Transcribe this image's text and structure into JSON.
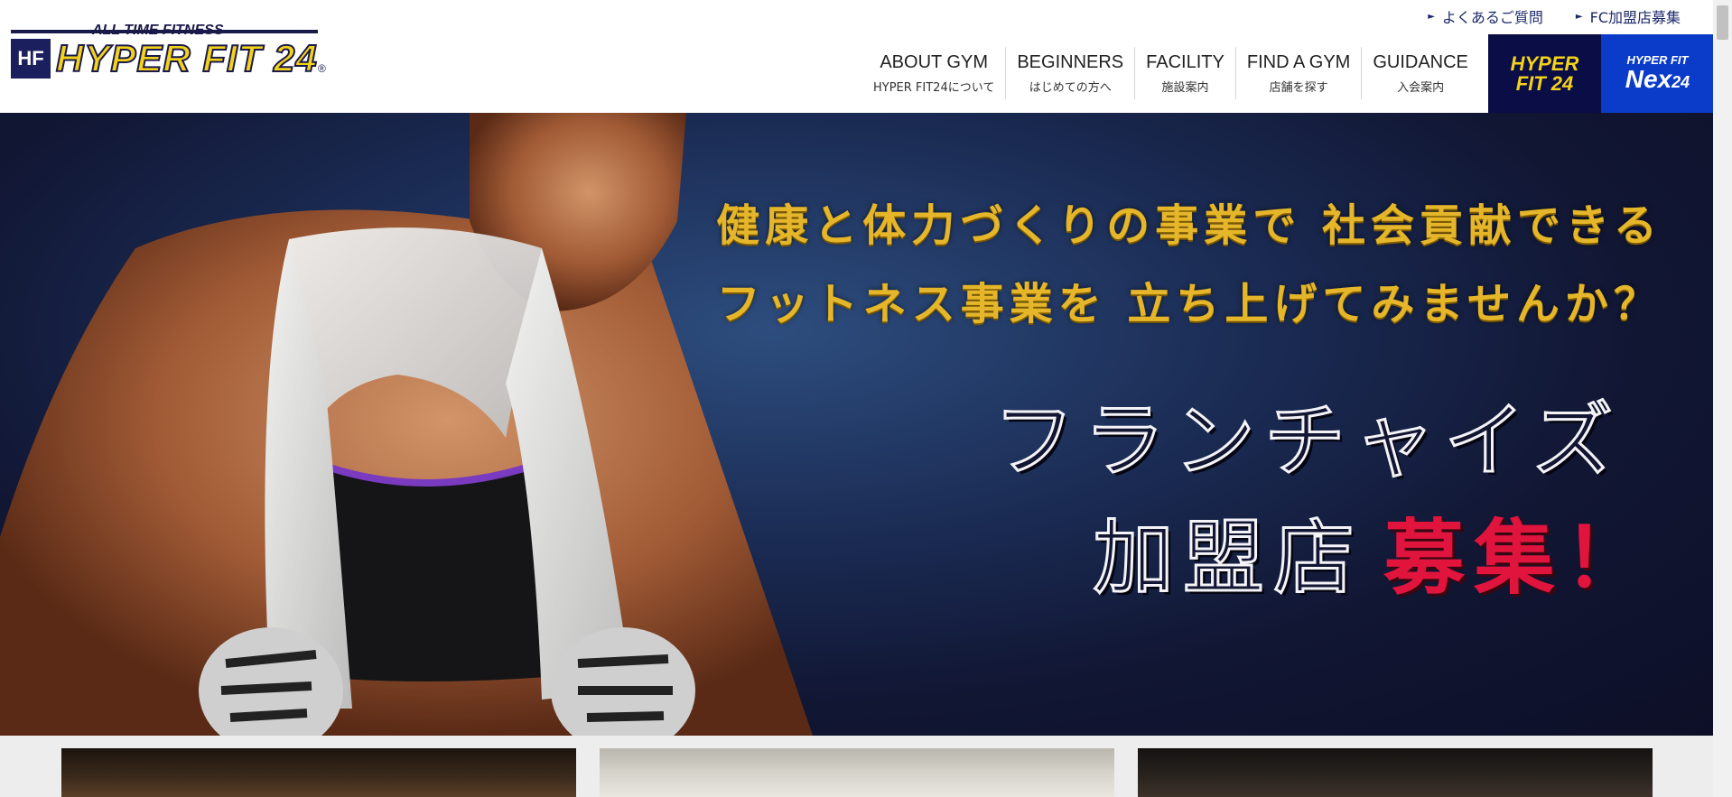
{
  "logo": {
    "tagline": "ALL TIME FITNESS",
    "mark": "HF",
    "wordmark": "HYPER FIT 24",
    "registered": "®"
  },
  "top_links": [
    {
      "label": "よくあるご質問"
    },
    {
      "label": "FC加盟店募集"
    }
  ],
  "nav": [
    {
      "en": "ABOUT GYM",
      "ja": "HYPER FIT24について"
    },
    {
      "en": "BEGINNERS",
      "ja": "はじめての方へ"
    },
    {
      "en": "FACILITY",
      "ja": "施設案内"
    },
    {
      "en": "FIND A GYM",
      "ja": "店舗を探す"
    },
    {
      "en": "GUIDANCE",
      "ja": "入会案内"
    }
  ],
  "brand_buttons": {
    "hyperfit": {
      "line1": "HYPER",
      "line2": "FIT 24"
    },
    "nex": {
      "top": "HYPER FIT",
      "main": "Nex",
      "num": "24"
    }
  },
  "hero": {
    "line1": "健康と体力づくりの事業で 社会貢献できる",
    "line2": "フットネス事業を 立ち上げてみませんか？",
    "big1": "フランチャイズ",
    "big2": "加盟店",
    "big2_red": "募集！"
  },
  "colors": {
    "gold": "#e5b62a",
    "navy": "#0b0d46",
    "blue": "#0a3cc9",
    "red": "#e0143d"
  }
}
